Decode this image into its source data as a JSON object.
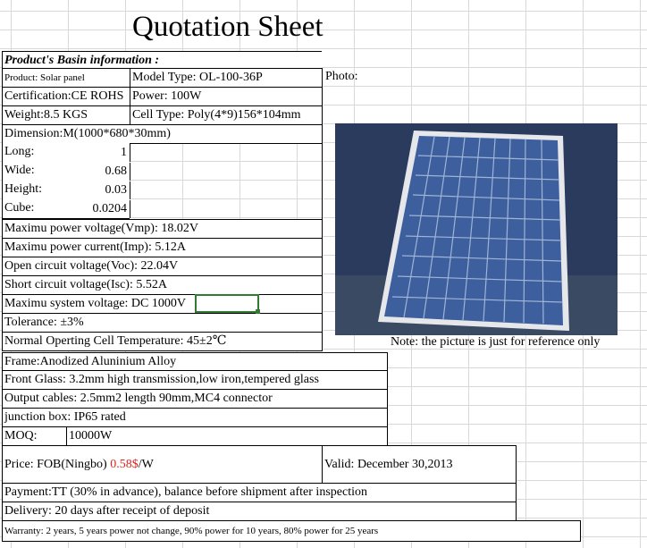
{
  "title": "Quotation Sheet",
  "basin_header": "Product's Basin information :",
  "product": "Product: Solar panel",
  "model_type": "Model Type: OL-100-36P",
  "photo_label": "Photo:",
  "certification": "Certification:CE ROHS",
  "power": "Power: 100W",
  "weight": "Weight:8.5 KGS",
  "cell_type": "Cell Type: Poly(4*9)156*104mm",
  "dimension": "Dimension:M(1000*680*30mm)",
  "dims": [
    {
      "label": "Long:",
      "value": "1"
    },
    {
      "label": "Wide:",
      "value": "0.68"
    },
    {
      "label": "Height:",
      "value": "0.03"
    },
    {
      "label": "Cube:",
      "value": "0.0204"
    }
  ],
  "vmp": "Maximu power voltage(Vmp): 18.02V",
  "imp": "Maximu power current(Imp): 5.12A",
  "voc": "Open circuit voltage(Voc): 22.04V",
  "isc": "Short circuit voltage(Isc): 5.52A",
  "sys_voltage": "Maximu system voltage:  DC 1000V",
  "tolerance": "Tolerance:    ±3%",
  "noct": "Normal Operting Cell Temperature:   45±2℃",
  "photo_note": "Note: the picture is just for reference only",
  "frame": "Frame:Anodized Aluninium Alloy",
  "glass": "Front Glass: 3.2mm high transmission,low iron,tempered glass",
  "cables": "Output cables: 2.5mm2 length 90mm,MC4 connector",
  "junction": "junction box: IP65 rated",
  "moq_label": "MOQ:",
  "moq_value": "10000W",
  "price_label": "Price: FOB(Ningbo)",
  "price_value": "0.58$",
  "price_unit": "/W",
  "valid": "Valid: December 30,2013",
  "payment": "Payment:TT (30% in advance),  balance before shipment after inspection",
  "delivery": "Delivery: 20 days after receipt of deposit",
  "warranty": "Warranty: 2 years,  5 years power not change, 90% power for 10 years, 80% power for 25 years",
  "colors": {
    "price_red": "#e0241b",
    "selection_green": "#2e7d32",
    "panel_blue": "#24355a"
  }
}
